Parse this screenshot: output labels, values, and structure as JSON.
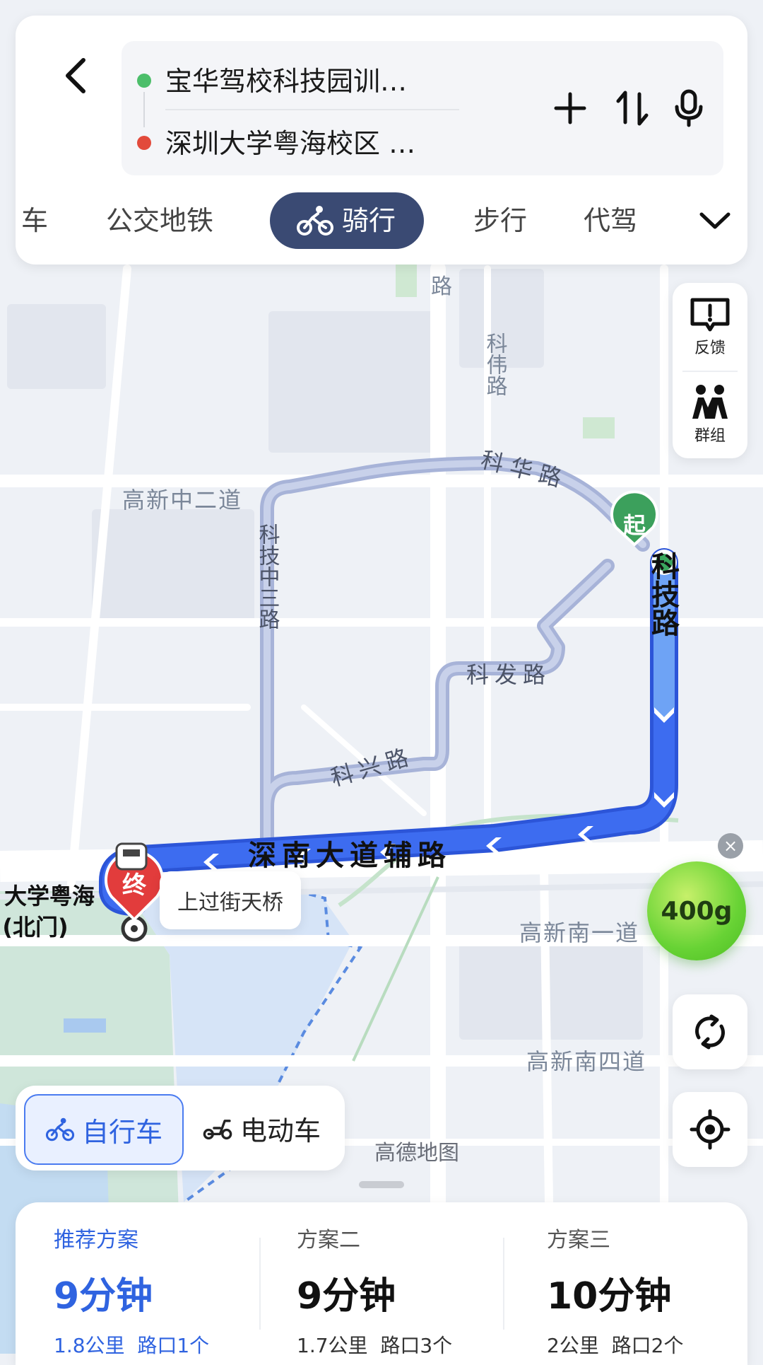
{
  "header": {
    "start": "宝华驾校科技园训…",
    "end": "深圳大学粤海校区 …",
    "start_color": "#4cbe6a",
    "end_color": "#e24a3b",
    "icons": [
      "back-icon",
      "add-icon",
      "swap-icon",
      "mic-icon"
    ],
    "modes": [
      {
        "label": "车",
        "active": false
      },
      {
        "label": "公交地铁",
        "active": false
      },
      {
        "label": "骑行",
        "active": true
      },
      {
        "label": "步行",
        "active": false
      },
      {
        "label": "代驾",
        "active": false
      }
    ]
  },
  "side": {
    "feedback": "反馈",
    "group": "群组"
  },
  "map": {
    "roads": [
      "科伟路",
      "科华路",
      "高新中二道",
      "科技中三路",
      "科技路",
      "科发路",
      "科兴路",
      "深南大道辅路",
      "高新南一道",
      "高新南四道",
      "路"
    ],
    "start_marker": "起",
    "end_marker": "终",
    "end_place_line1": "大学粤海",
    "end_place_line2": "(北门)",
    "tip": "上过街天桥",
    "watermark": "高德地图",
    "route_color": "#3d6cf0"
  },
  "carbon": {
    "value": "400g"
  },
  "bike_types": {
    "bike": "自行车",
    "ebike": "电动车",
    "selected": "自行车"
  },
  "plans": [
    {
      "title": "推荐方案",
      "time": "9分钟",
      "distance": "1.8公里",
      "crossings": "路口1个"
    },
    {
      "title": "方案二",
      "time": "9分钟",
      "distance": "1.7公里",
      "crossings": "路口3个"
    },
    {
      "title": "方案三",
      "time": "10分钟",
      "distance": "2公里",
      "crossings": "路口2个"
    }
  ]
}
